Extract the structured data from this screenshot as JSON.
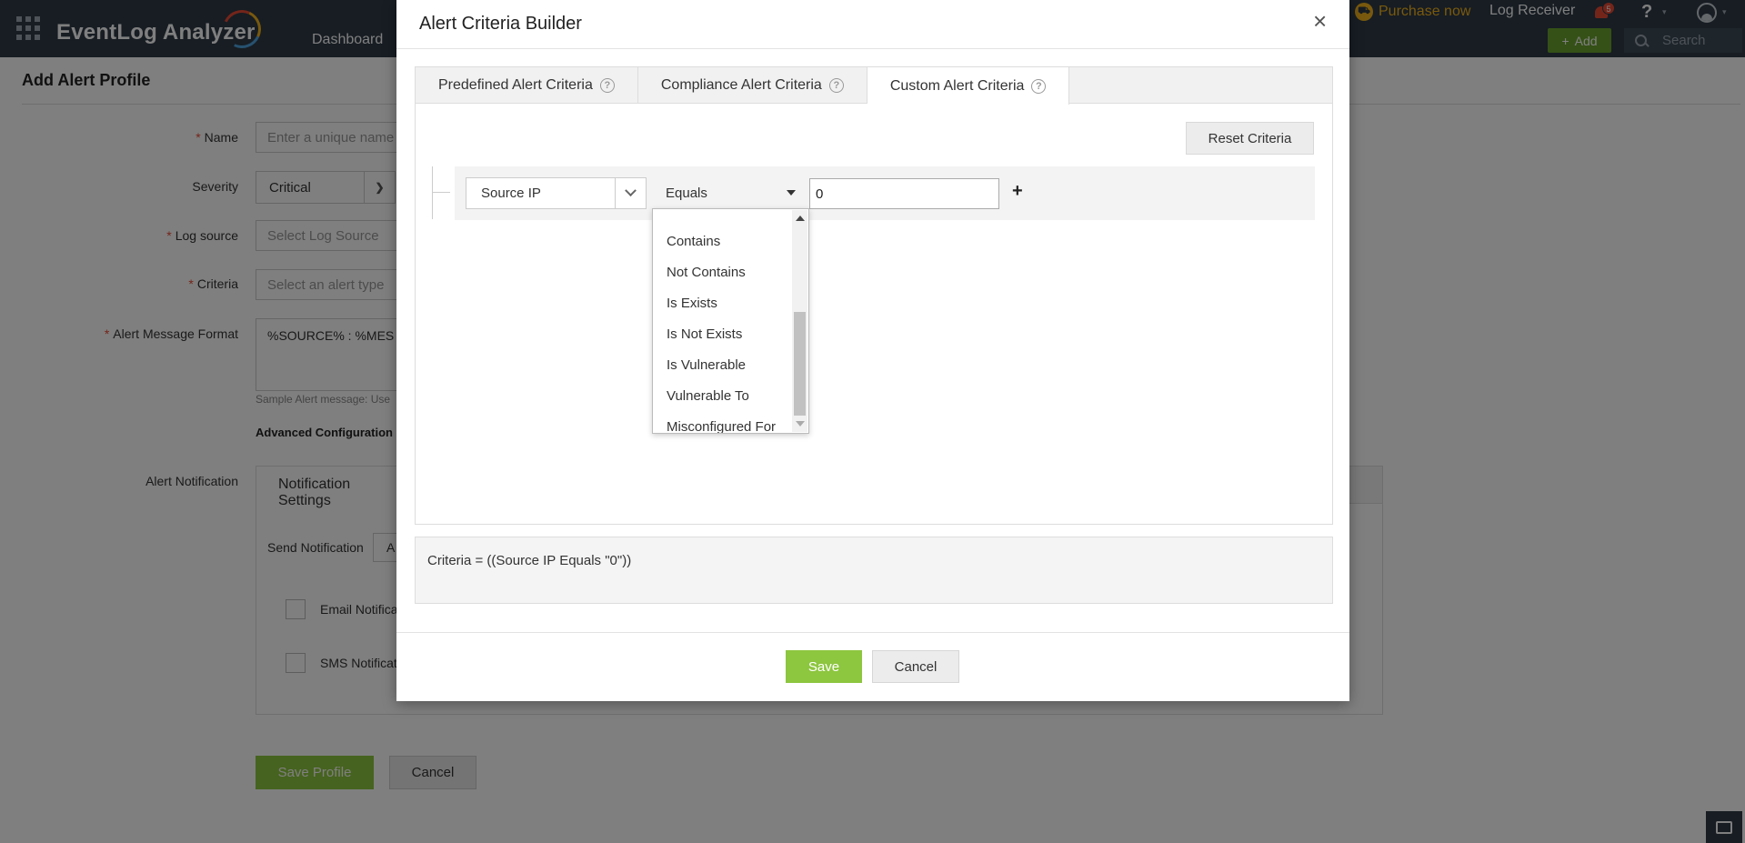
{
  "header": {
    "app_name": "EventLog Analyzer",
    "nav_dashboard": "Dashboard",
    "purchase_label": "Purchase now",
    "log_receiver_label": "Log Receiver",
    "notification_count": "5",
    "help_label": "?",
    "add_label": "Add",
    "search_placeholder": "Search"
  },
  "page": {
    "title": "Add Alert Profile",
    "form": {
      "name_label": "Name",
      "name_placeholder": "Enter a unique name",
      "severity_label": "Severity",
      "severity_value": "Critical",
      "log_source_label": "Log source",
      "log_source_placeholder": "Select Log Source",
      "criteria_label": "Criteria",
      "criteria_placeholder": "Select an alert type",
      "message_format_label": "Alert Message Format",
      "message_format_value": "%SOURCE% : %MES",
      "sample_message": "Sample Alert message: Use",
      "advanced_config": "Advanced Configuration",
      "notification_label": "Alert Notification",
      "notification_settings_tab": "Notification Settings",
      "send_notification_label": "Send Notification",
      "send_notification_value": "A",
      "email_notification": "Email Notification",
      "sms_notification": "SMS Notification",
      "save_profile": "Save Profile",
      "cancel": "Cancel",
      "required_marker": "*"
    }
  },
  "modal": {
    "title": "Alert Criteria Builder",
    "close_glyph": "×",
    "tabs": [
      {
        "label": "Predefined Alert Criteria"
      },
      {
        "label": "Compliance Alert Criteria"
      },
      {
        "label": "Custom Alert Criteria"
      }
    ],
    "reset_label": "Reset Criteria",
    "condition": {
      "field": "Source IP",
      "operator": "Equals",
      "value": "0",
      "add_glyph": "+"
    },
    "operator_options": [
      "Contains",
      "Not Contains",
      "Is Exists",
      "Is Not Exists",
      "Is Vulnerable",
      "Vulnerable To",
      "Misconfigured For"
    ],
    "criteria_expression": "Criteria = ((Source IP Equals \"0\"))",
    "save_label": "Save",
    "cancel_label": "Cancel"
  },
  "colors": {
    "topbar": "#2e3b47",
    "accent_green": "#8dc63f",
    "purchase": "#f3b21d",
    "required": "#e94b35"
  }
}
